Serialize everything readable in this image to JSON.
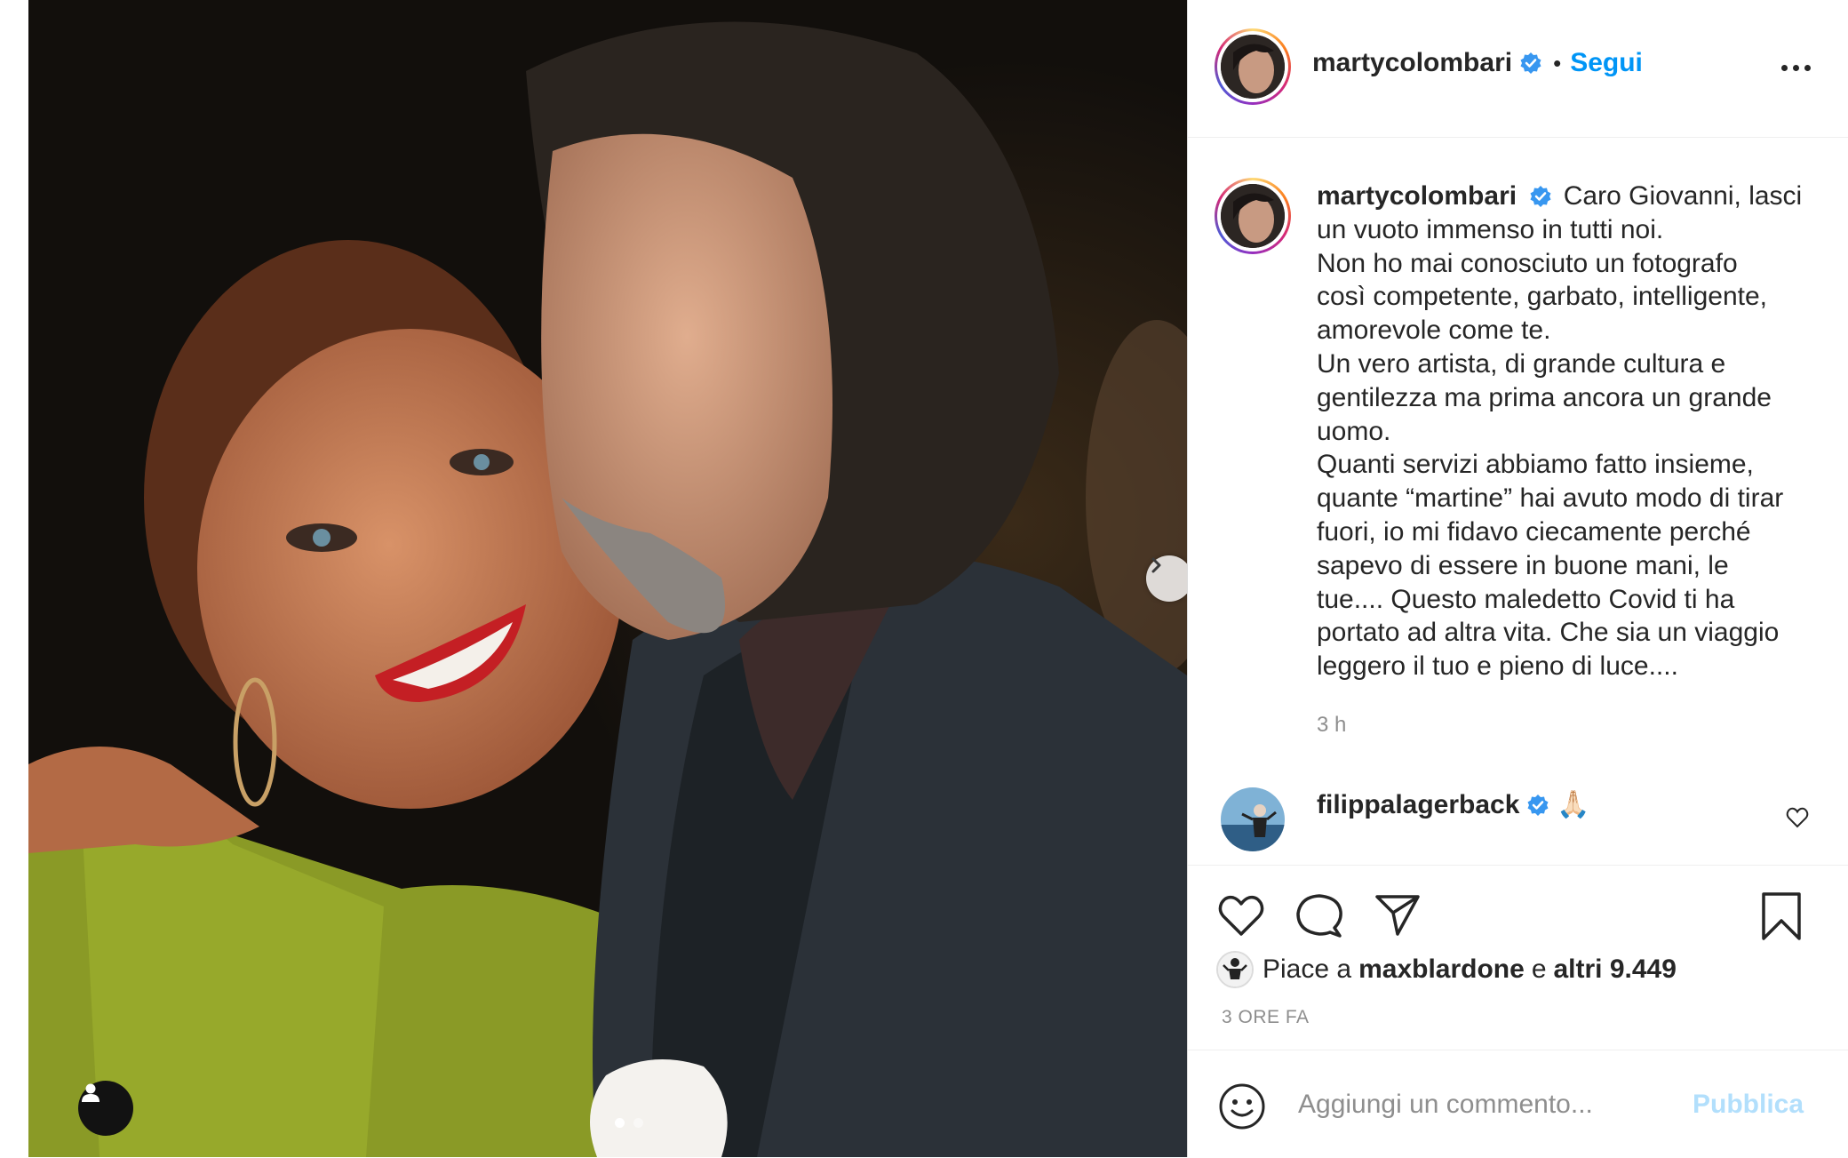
{
  "post": {
    "username": "martycolombari",
    "follow_label": "Segui",
    "separator": "•",
    "caption_lines": [
      "Caro Giovanni, lasci",
      "un vuoto immenso in tutti noi.",
      "Non ho mai conosciuto un fotografo",
      "così competente, garbato, intelligente,",
      "amorevole come te.",
      "Un vero artista, di grande cultura e",
      "gentilezza ma prima ancora un grande",
      "uomo.",
      "Quanti servizi abbiamo fatto insieme,",
      "quante “martine” hai avuto modo di tirar",
      "fuori, io mi fidavo ciecamente perché",
      "sapevo di essere in buone mani, le",
      "tue.... Questo maledetto Covid ti ha",
      "portato ad altra vita. Che sia un viaggio",
      "leggero il tuo e pieno di luce...."
    ],
    "caption_time": "3 h"
  },
  "comment": {
    "username": "filippalagerback",
    "emoji": "🙏🏻"
  },
  "likes": {
    "prefix": "Piace a",
    "user": "maxblardone",
    "joiner": "e",
    "others": "altri 9.449"
  },
  "posted_ago": "3 ORE FA",
  "comment_box": {
    "placeholder": "Aggiungi un commento...",
    "publish_label": "Pubblica"
  },
  "carousel": {
    "current": 1,
    "total": 2
  },
  "colors": {
    "accent": "#0095f6",
    "verified": "#3897f0",
    "publish_disabled": "#b2dffc",
    "muted": "#8e8e8e"
  },
  "icons": [
    "chevron-right-icon",
    "user-tag-icon",
    "more-icon",
    "verified-icon",
    "heart-icon",
    "comment-icon",
    "share-icon",
    "bookmark-icon",
    "emoji-icon"
  ]
}
